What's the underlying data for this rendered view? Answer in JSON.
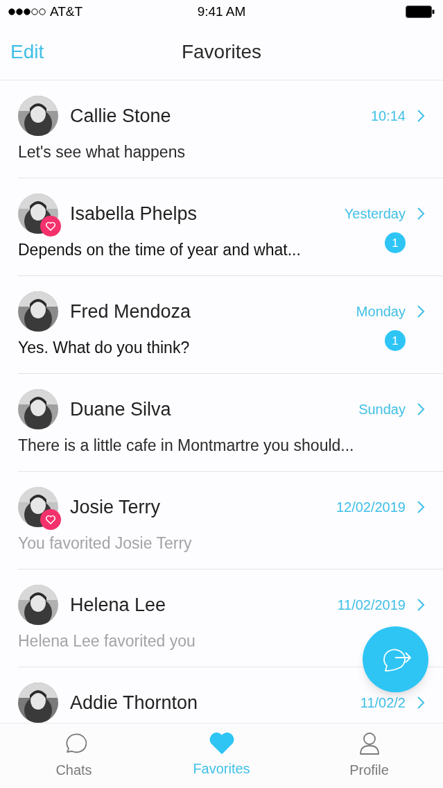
{
  "status_bar": {
    "carrier": "AT&T",
    "time": "9:41 AM"
  },
  "nav": {
    "edit": "Edit",
    "title": "Favorites"
  },
  "chats": [
    {
      "name": "Callie Stone",
      "time": "10:14",
      "message": "Let's see what happens",
      "kind": "message",
      "favorite": false
    },
    {
      "name": "Isabella Phelps",
      "time": "Yesterday",
      "message": "Depends on the time of year and what...",
      "kind": "message",
      "favorite": true,
      "unread": "1"
    },
    {
      "name": "Fred Mendoza",
      "time": "Monday",
      "message": "Yes. What do you think?",
      "kind": "message",
      "favorite": false,
      "unread": "1"
    },
    {
      "name": "Duane Silva",
      "time": "Sunday",
      "message": "There is a little cafe in Montmartre you should...",
      "kind": "message",
      "favorite": false
    },
    {
      "name": "Josie Terry",
      "time": "12/02/2019",
      "message": "You favorited Josie Terry",
      "kind": "event",
      "favorite": true
    },
    {
      "name": "Helena Lee",
      "time": "11/02/2019",
      "message": "Helena Lee favorited you",
      "kind": "event",
      "favorite": false
    },
    {
      "name": "Addie Thornton",
      "time": "11/02/2",
      "favorite": false
    }
  ],
  "tabs": [
    {
      "label": "Chats",
      "kind": "chats",
      "selected": false
    },
    {
      "label": "Favorites",
      "kind": "favorites",
      "selected": true
    },
    {
      "label": "Profile",
      "kind": "profile",
      "selected": false
    }
  ]
}
